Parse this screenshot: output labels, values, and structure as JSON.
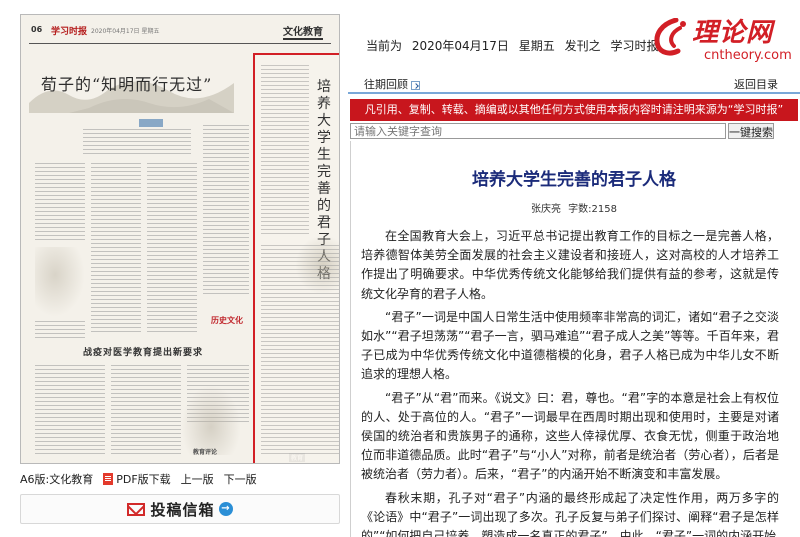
{
  "paper": {
    "page_num": "06",
    "masthead": "学习时报",
    "masthead_date": "2020年04月17日 星期五",
    "section": "文化教育",
    "article1_title": "荀子的“知明而行无过”",
    "article2_title": "战疫对医学教育提出新要求",
    "highlight_title": "培养大学生完善的君子人格",
    "badge_text": "历史文化",
    "footer1": "教育评论",
    "footer2": "教育"
  },
  "page_nav": {
    "edition": "A6版:文化教育",
    "pdf": "PDF版下载",
    "prev": "上一版",
    "next": "下一版"
  },
  "submit": {
    "label": "投稿信箱"
  },
  "info_line": {
    "prefix": "当前为",
    "date": "2020年04月17日",
    "weekday": "星期五",
    "issue": "发刊之",
    "paper": "学习时报"
  },
  "logo": {
    "cn": "理论网",
    "en": "cntheory.com"
  },
  "toolbar": {
    "past": "往期回顾",
    "back": "返回目录"
  },
  "notice": "凡引用、复制、转载、摘编或以其他任何方式使用本报内容时请注明来源为“学习时报”",
  "search": {
    "placeholder": "请输入关键字查询",
    "button": "一键搜索"
  },
  "article": {
    "title": "培养大学生完善的君子人格",
    "author": "张庆亮",
    "word_count": "字数:2158",
    "paragraphs": [
      "在全国教育大会上，习近平总书记提出教育工作的目标之一是完善人格，培养德智体美劳全面发展的社会主义建设者和接班人，这对高校的人才培养工作提出了明确要求。中华优秀传统文化能够给我们提供有益的参考，这就是传统文化孕育的君子人格。",
      "“君子”一词是中国人日常生活中使用频率非常高的词汇，诸如“君子之交淡如水”“君子坦荡荡”“君子一言，驷马难追”“君子成人之美”等等。千百年来，君子已成为中华优秀传统文化中道德楷模的化身，君子人格已成为中华儿女不断追求的理想人格。",
      "“君子”从“君”而来。《说文》曰：君，尊也。“君”字的本意是社会上有权位的人、处于高位的人。“君子”一词最早在西周时期出现和使用时，主要是对诸侯国的统治者和贵族男子的通称，这些人倖禄优厚、衣食无忧，侧重于政治地位而非道德品质。此时“君子”与“小人”对称，前者是统治者（劳心者），后者是被统治者（劳力者）。后来，“君子”的内涵开始不断演变和丰富发展。",
      "春秋末期，孔子对“君子”内涵的最终形成起了决定性作用，两万多字的《论语》中“君子”一词出现了多次。孔子反复与弟子们探讨、阐释“君子是怎样的”“如何把自己培养、塑造成一名真正的君子”，由此，“君子”一词的内涵开始"
    ]
  }
}
